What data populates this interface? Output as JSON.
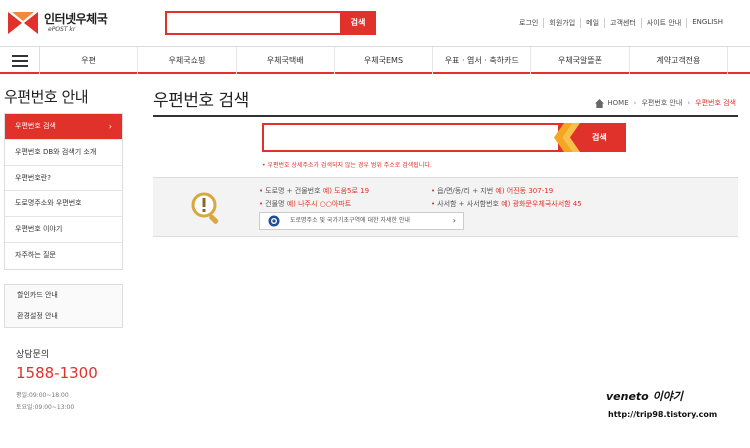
{
  "header": {
    "logo_title": "인터넷우체국",
    "logo_sub": "ePOST kr",
    "search_button": "검색",
    "util_links": [
      "로그인",
      "회원가입",
      "메일",
      "고객센터",
      "사이트 안내",
      "ENGLISH"
    ]
  },
  "gnb": {
    "items": [
      "우편",
      "우체국쇼핑",
      "우체국택배",
      "우체국EMS",
      "우표 · 엽서 · 축하카드",
      "우체국알뜰폰",
      "계약고객전용"
    ]
  },
  "sidebar": {
    "title": "우편번호 안내",
    "items": [
      "우편번호 검색",
      "우편번호 DB와 검색기 소개",
      "우편번호란?",
      "도로명주소와 우편번호",
      "우편번호 이야기",
      "자주하는 질문"
    ],
    "extra_items": [
      "할인카드 안내",
      "환경설정 안내"
    ],
    "cs_title": "상담문의",
    "cs_phone": "1588-1300",
    "cs_hours_weekday": "평일:09:00~18:00",
    "cs_hours_saturday": "토요일:09:00~13:00"
  },
  "main": {
    "title": "우편번호 검색",
    "breadcrumb": [
      "HOME",
      "우편번호 안내",
      "우편번호 검색"
    ],
    "search_button": "검색",
    "search_value": "",
    "notice": "• 우편번호 상세주소가 검색되지 않는 경우 범위 주소로 검색됩니다.",
    "guide": {
      "left": [
        {
          "label": "도로명 + 건물번호",
          "example": "예) 도움5로 19"
        },
        {
          "label": "건물명",
          "example": "예) 나주시 ○○아파트"
        }
      ],
      "right": [
        {
          "label": "읍/면/동/리 + 지번",
          "example": "예) 어진동 307-19"
        },
        {
          "label": "사서함 + 사서함번호",
          "example": "예) 광화문우체국사서함 45"
        }
      ],
      "link": "도로명주소 및 국가기초구역에 대한 자세한 안내"
    }
  },
  "watermark": {
    "line1": "veneto 이야기",
    "line2": "http://trip98.tistory.com"
  },
  "colors": {
    "accent": "#e0312b",
    "guide_bg": "#f3f3f3",
    "icon_gold": "#d9a73e"
  }
}
